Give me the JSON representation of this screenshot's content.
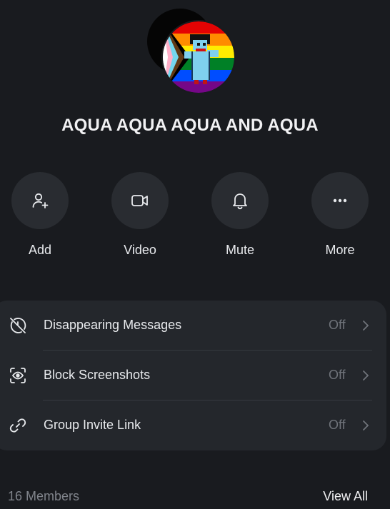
{
  "group": {
    "title": "AQUA AQUA AQUA AND AQUA"
  },
  "avatar": {
    "back_color": "#050505",
    "front_description_icon": "pixel-character-on-progress-pride-flag"
  },
  "actions": [
    {
      "label": "Add",
      "icon": "add-user-icon"
    },
    {
      "label": "Video",
      "icon": "video-camera-icon"
    },
    {
      "label": "Mute",
      "icon": "bell-icon"
    },
    {
      "label": "More",
      "icon": "ellipsis-icon"
    }
  ],
  "settings": [
    {
      "label": "Disappearing Messages",
      "value": "Off",
      "icon": "timer-off-icon"
    },
    {
      "label": "Block Screenshots",
      "value": "Off",
      "icon": "screenshot-eye-icon"
    },
    {
      "label": "Group Invite Link",
      "value": "Off",
      "icon": "link-icon"
    }
  ],
  "members": {
    "count_label": "16 Members",
    "view_all_label": "View All"
  },
  "colors": {
    "background": "#191b1f",
    "circle_button": "#292c31",
    "card": "#24272c",
    "muted_text": "#6f737a"
  }
}
